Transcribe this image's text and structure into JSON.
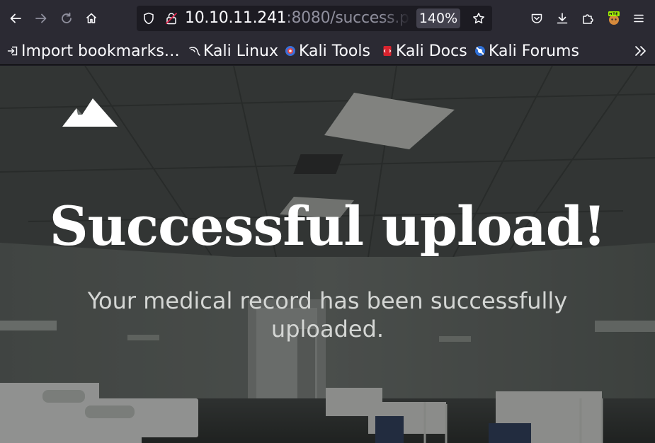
{
  "toolbar": {
    "url_host": "10.10.11.241",
    "url_rest": ":8080/success.p",
    "zoom": "140%"
  },
  "bookmarks": {
    "items": [
      {
        "label": "Import bookmarks…",
        "icon": "import-icon"
      },
      {
        "label": "Kali Linux",
        "icon": "kali-dragon-icon"
      },
      {
        "label": "Kali Tools",
        "icon": "kali-tools-icon"
      },
      {
        "label": "Kali Docs",
        "icon": "kali-docs-icon"
      },
      {
        "label": "Kali Forums",
        "icon": "kali-forums-icon"
      }
    ]
  },
  "page": {
    "title": "Successful upload!",
    "subtitle": "Your medical record has been successfully uploaded."
  },
  "colors": {
    "toolbar_bg": "#2b2a33",
    "urlbar_bg": "#1c1b22",
    "text": "#fbfbfe"
  }
}
